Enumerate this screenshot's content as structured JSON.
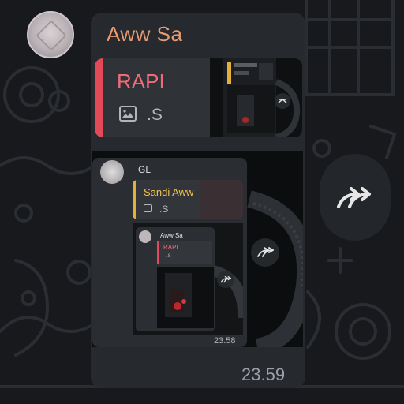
{
  "message": {
    "sender": "Aww Sa",
    "reply": {
      "title": "RAPI",
      "media_text": ".S"
    },
    "time": "23.59"
  },
  "nested_1": {
    "sender": "GL",
    "reply": {
      "title": "Sandi Aww",
      "media_text": ".S"
    },
    "time": "23.58"
  },
  "nested_2": {
    "sender": "Aww Sa",
    "reply_title": "RAPI",
    "media_text": ".S"
  },
  "colors": {
    "background": "#17191c",
    "bubble": "#26292d",
    "sender_name": "#e89a72",
    "reply_accent": "#e24a5a",
    "reply_title": "#ec6c78",
    "nested_reply_accent": "#e3b03c"
  },
  "icons": {
    "forward": "forward-arrow-icon",
    "media": "image-icon"
  }
}
